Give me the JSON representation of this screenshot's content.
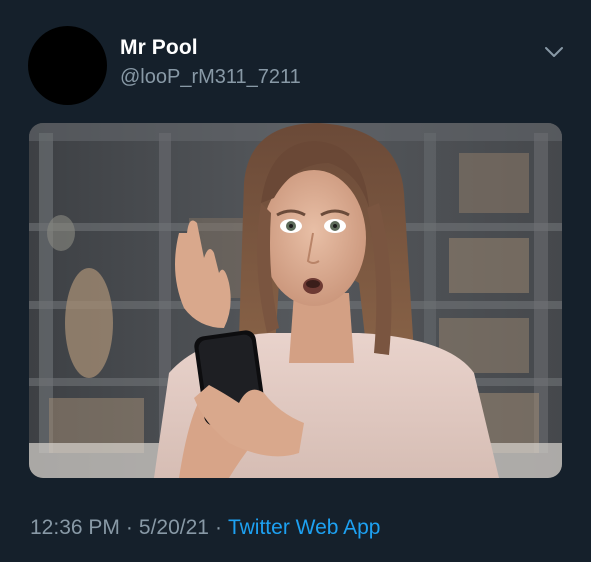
{
  "tweet": {
    "display_name": "Mr Pool",
    "handle": "@looP_rM311_7211",
    "time": "12:36 PM",
    "date": "5/20/21",
    "separator": "·",
    "source": "Twitter Web App"
  },
  "icons": {
    "menu": "chevron-down-icon"
  },
  "colors": {
    "background": "#15202b",
    "secondary_text": "#8899a6",
    "link": "#1da1f2"
  }
}
